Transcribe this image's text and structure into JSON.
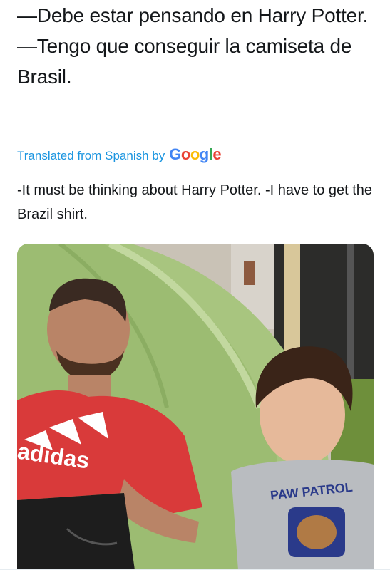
{
  "tweet": {
    "lines": [
      "—Debe estar pensando en Harry Potter.",
      "—Tengo que conseguir la camiseta de Brasil."
    ]
  },
  "translation": {
    "label": "Translated from Spanish by",
    "provider_letters": [
      "G",
      "o",
      "o",
      "g",
      "l",
      "e"
    ],
    "text": "-It must be thinking about Harry Potter. -I have to get the Brazil shirt."
  },
  "photo": {
    "shirt_brand_text": "adidas",
    "kid_shirt_text": "PAW PATROL"
  },
  "colors": {
    "link": "#1b95e0",
    "text": "#14171a"
  }
}
